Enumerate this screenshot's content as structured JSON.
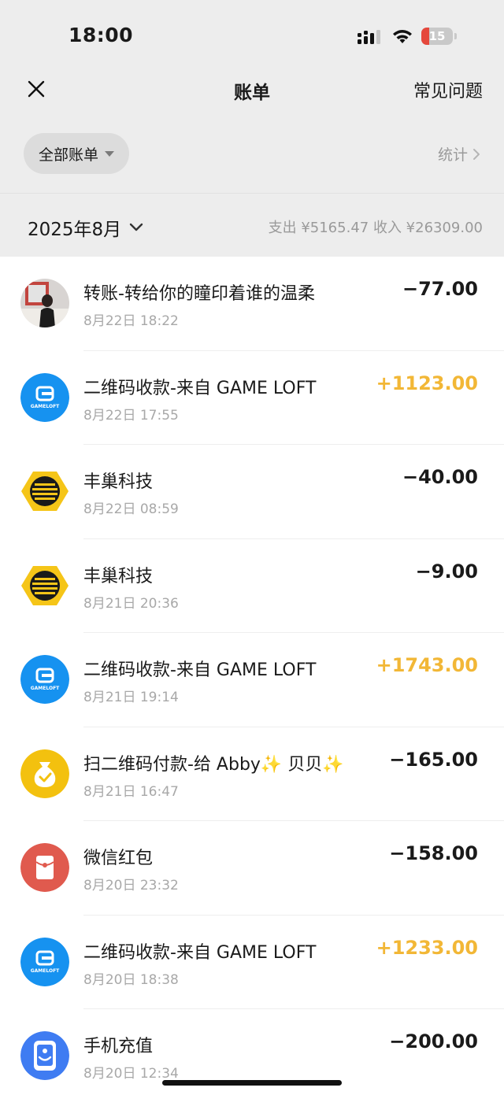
{
  "status_bar": {
    "time": "18:00",
    "battery_level": "15"
  },
  "nav": {
    "title": "账单",
    "faq": "常见问题"
  },
  "filter": {
    "label": "全部账单",
    "stats": "统计"
  },
  "month": {
    "label": "2025年8月",
    "summary": "支出 ¥5165.47  收入 ¥26309.00"
  },
  "transactions": [
    {
      "title": "转账-转给你的瞳印着谁的温柔",
      "time": "8月22日 18:22",
      "amount": "−77.00",
      "icon": "user-photo-avatar"
    },
    {
      "title": "二维码收款-来自 GAME LOFT",
      "time": "8月22日 17:55",
      "amount": "+1123.00",
      "icon": "gameloft-logo"
    },
    {
      "title": "丰巢科技",
      "time": "8月22日 08:59",
      "amount": "−40.00",
      "icon": "hive-box-logo"
    },
    {
      "title": "丰巢科技",
      "time": "8月21日 20:36",
      "amount": "−9.00",
      "icon": "hive-box-logo"
    },
    {
      "title": "二维码收款-来自 GAME LOFT",
      "time": "8月21日 19:14",
      "amount": "+1743.00",
      "icon": "gameloft-logo"
    },
    {
      "title": "扫二维码付款-给 Abby✨ 贝贝✨",
      "time": "8月21日 16:47",
      "amount": "−165.00",
      "icon": "money-bag-icon"
    },
    {
      "title": "微信红包",
      "time": "8月20日 23:32",
      "amount": "−158.00",
      "icon": "red-packet-icon"
    },
    {
      "title": "二维码收款-来自 GAME LOFT",
      "time": "8月20日 18:38",
      "amount": "+1233.00",
      "icon": "gameloft-logo"
    },
    {
      "title": "手机充值",
      "time": "8月20日 12:34",
      "amount": "−200.00",
      "icon": "phone-recharge-icon"
    }
  ],
  "colors": {
    "income": "#f2b736",
    "expense": "#1a1a1a",
    "background_gray": "#ededed"
  }
}
